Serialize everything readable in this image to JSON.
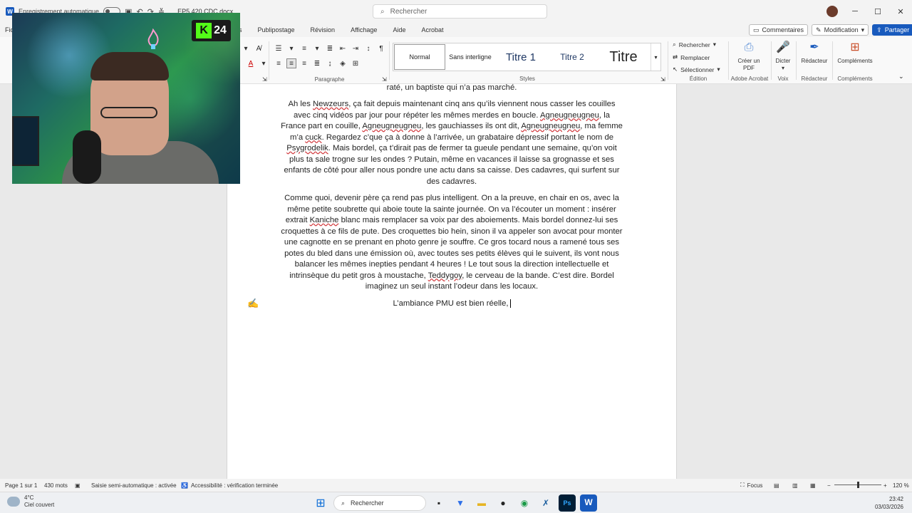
{
  "titlebar": {
    "autosave_label": "Enregistrement automatique",
    "doc_name": "EP5 420 CDC.docx",
    "search_placeholder": "Rechercher"
  },
  "menu": {
    "left_tab": "Fic",
    "tabs": [
      "s",
      "Publipostage",
      "Révision",
      "Affichage",
      "Aide",
      "Acrobat"
    ],
    "comments_label": "Commentaires",
    "mode_label": "Modification",
    "share_label": "Partager"
  },
  "ribbon": {
    "paragraph_label": "Paragraphe",
    "styles_label": "Styles",
    "styles": [
      "Normal",
      "Sans interligne",
      "Titre 1",
      "Titre 2",
      "Titre"
    ],
    "edition_label": "Édition",
    "edit_items": [
      "Rechercher",
      "Remplacer",
      "Sélectionner"
    ],
    "acrobat": {
      "button": "Créer un PDF",
      "group": "Adobe Acrobat"
    },
    "voice": {
      "button": "Dicter",
      "group": "Voix"
    },
    "editor": {
      "button": "Rédacteur",
      "group": "Rédacteur"
    },
    "addins": {
      "button": "Compléments",
      "group": "Compléments"
    }
  },
  "document": {
    "line0": "raté, un baptiste qui n’a pas marché.",
    "p1": {
      "s1": "Ah les ",
      "w1": "Newzeurs",
      "s2": ", ça fait depuis maintenant cinq ans qu’ils viennent nous casser les couilles avec cinq vidéos par jour pour répéter les mêmes merdes en boucle. ",
      "w2": "Agneugneugneu",
      "s3": ", la France part en couille, ",
      "w3": "Agneugneugneu",
      "s4": ", les gauchiasses ils ont dit, ",
      "w4": "Agneugneugneu",
      "s5": ", ma femme m’a ",
      "w5": "cuck",
      "s6": ". Regardez c’que ça à donne à l’arrivée, un grabataire dépressif portant le nom de ",
      "w6": "Psygrodelik",
      "s7": ". Mais bordel, ça t’dirait pas de fermer ta gueule pendant une semaine, qu’on voit plus ta sale trogne sur les ondes ? Putain, même en vacances il laisse sa grognasse et ses enfants de côté pour aller nous pondre une actu dans sa caisse. Des cadavres, qui surfent sur des cadavres."
    },
    "p2": {
      "s1": "Comme quoi, devenir père ça rend pas plus intelligent. On a la preuve, en chair en os, avec la même petite soubrette qui aboie toute la sainte journée. On va l’écouter un moment : insérer extrait ",
      "w1": "Kaniche",
      "s2": " blanc mais remplacer sa voix par des aboiements. Mais bordel donnez-lui ses croquettes à ce fils de pute. Des croquettes bio hein, sinon il va appeler son avocat pour monter une cagnotte en se prenant en photo genre je souffre. Ce gros tocard nous a ramené tous ses potes du bled dans une émission où, avec toutes ses petits élèves qui le suivent, ils vont nous balancer les mêmes inepties pendant 4 heures ! Le tout sous la direction intellectuelle et intrinsèque du petit gros à moustache, ",
      "w2": "Teddygoy",
      "s3": ", le cerveau de la bande. C’est dire. Bordel imaginez un seul instant l’odeur dans les locaux."
    },
    "p3": "L’ambiance PMU est bien réelle,"
  },
  "overlay": {
    "badge_letter": "K",
    "badge_number": "24"
  },
  "statusbar": {
    "page": "Page 1 sur 1",
    "words": "430 mots",
    "autocomplete": "Saisie semi-automatique : activée",
    "accessibility": "Accessibilité : vérification terminée",
    "focus": "Focus",
    "zoom": "120 %"
  },
  "taskbar": {
    "temp": "4°C",
    "weather": "Ciel couvert",
    "search": "Rechercher",
    "time": "23:42",
    "date": "03/03/2026"
  },
  "colors": {
    "word_blue": "#185abd",
    "kick_green": "#53fc18",
    "spell_red": "#d13438"
  }
}
